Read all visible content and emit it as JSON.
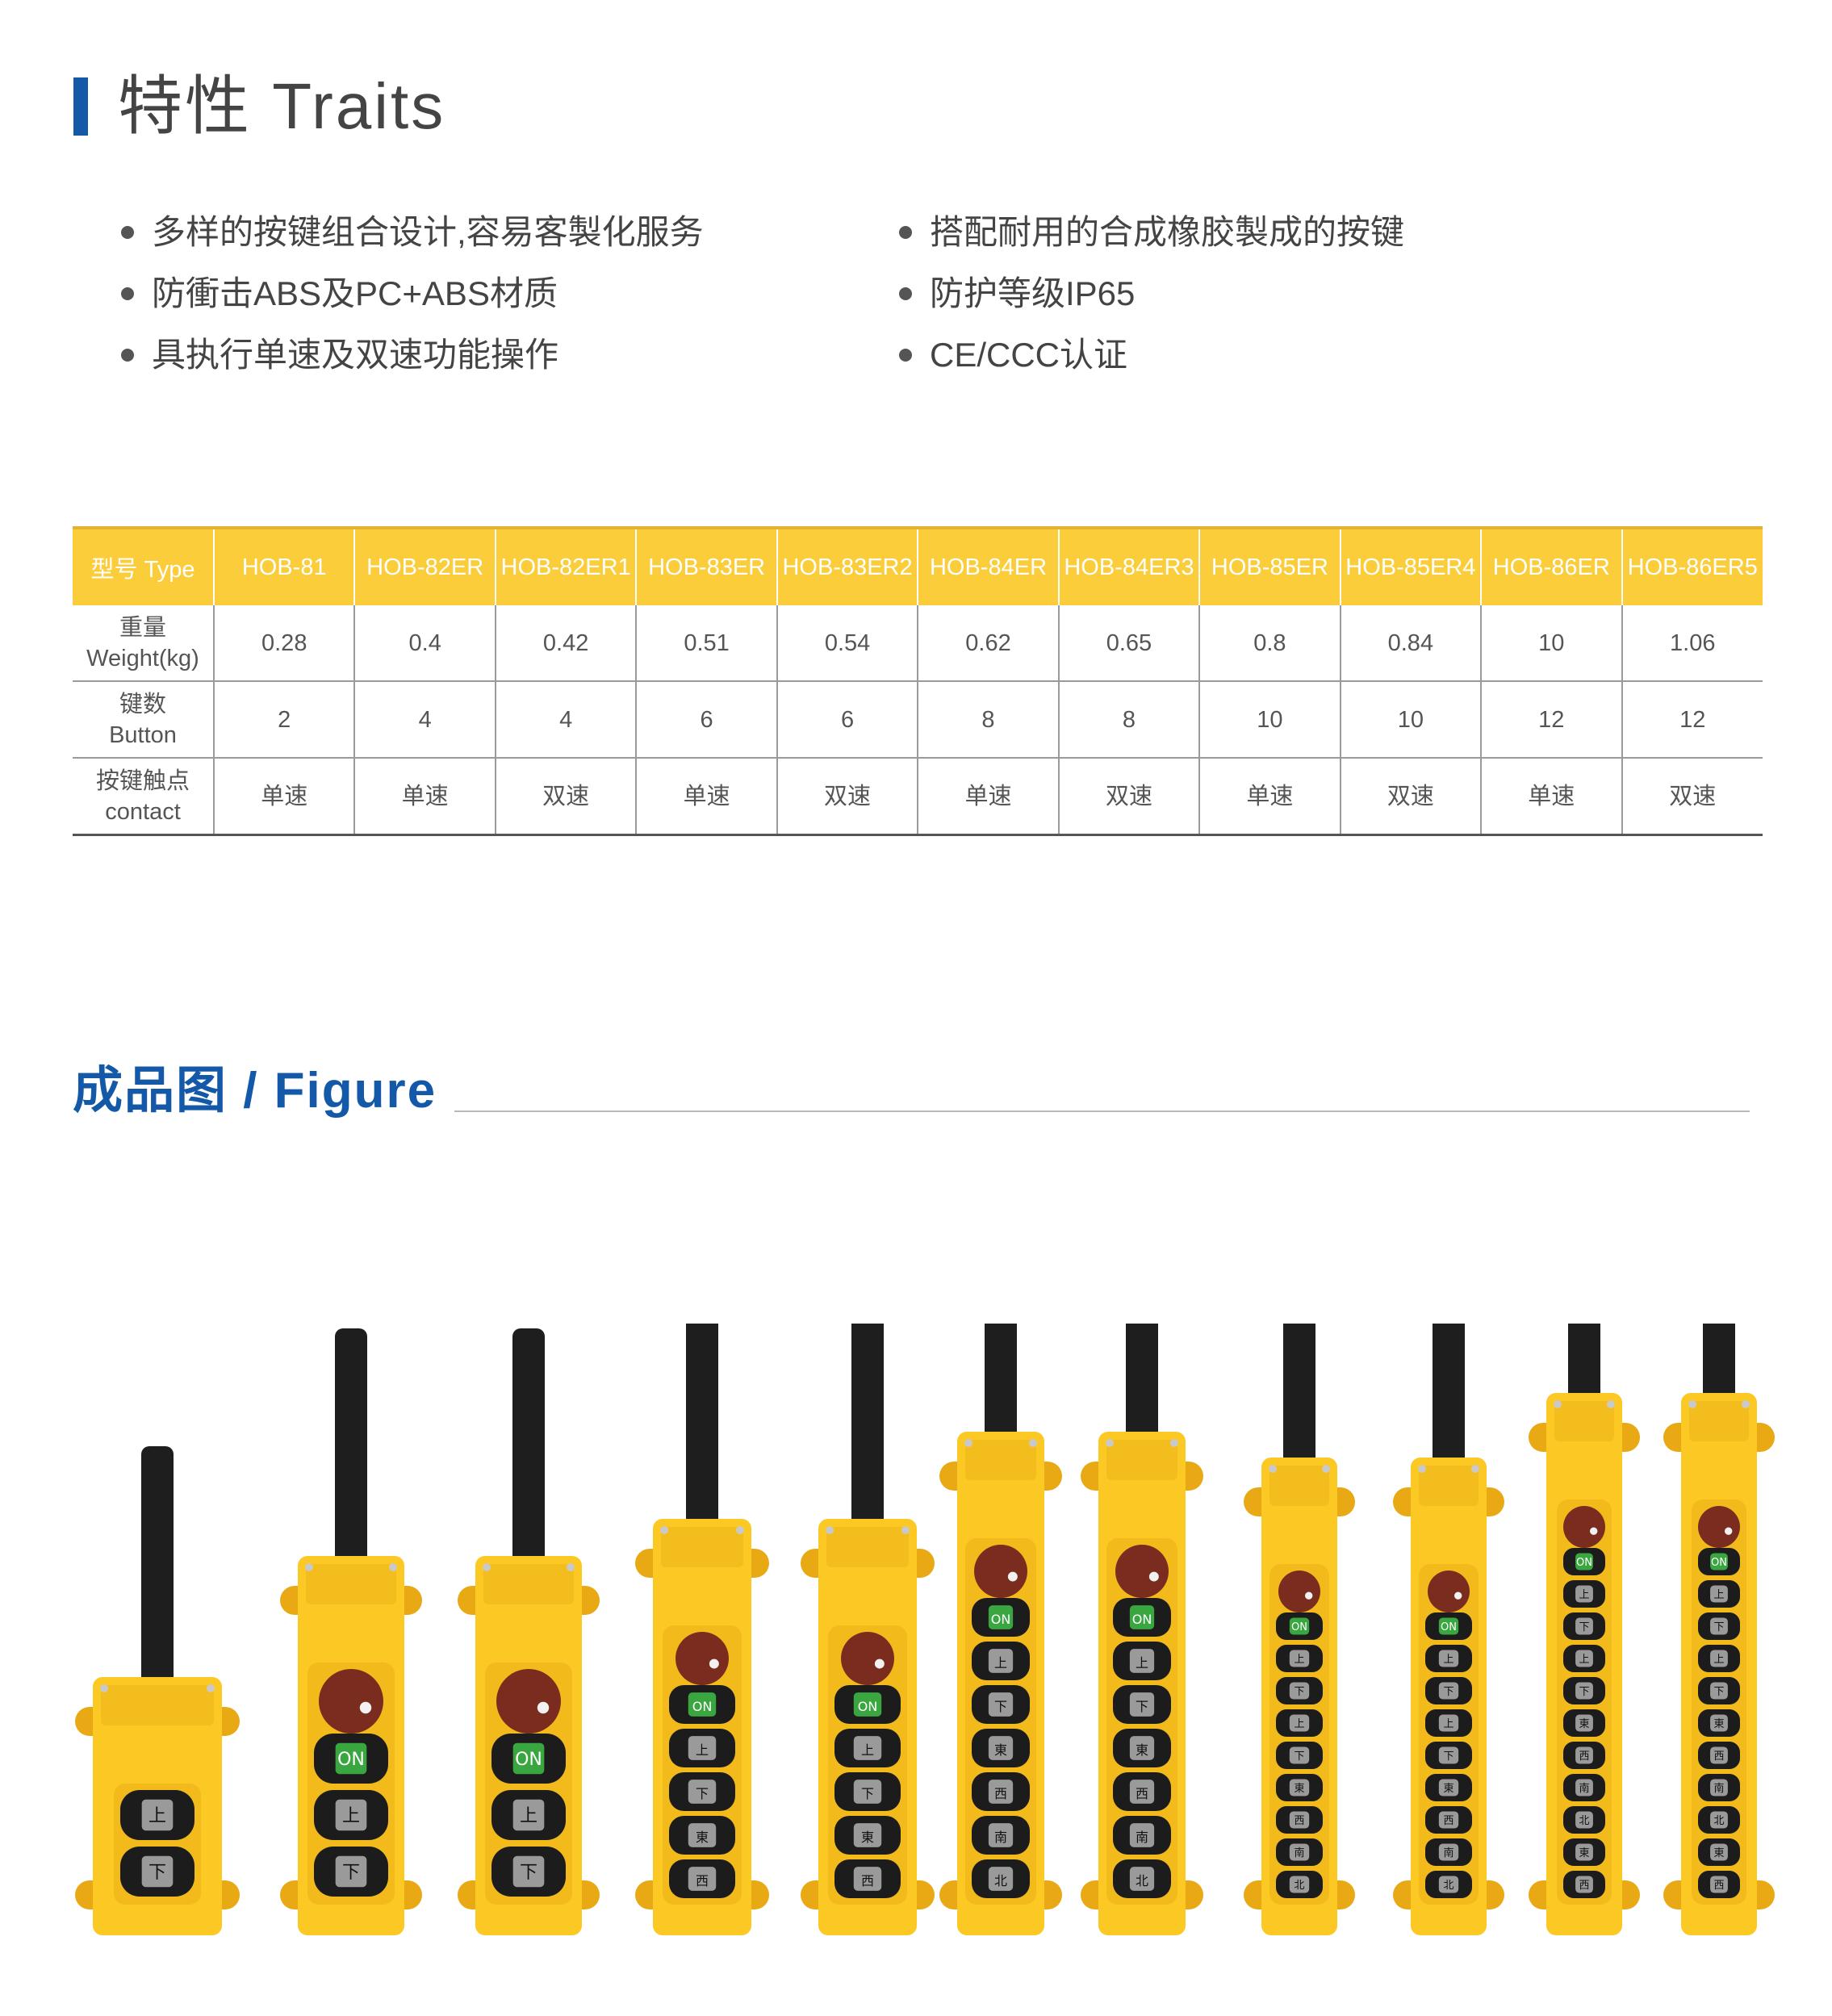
{
  "traits": {
    "title": "特性 Traits",
    "left": [
      "多样的按键组合设计,容易客製化服务",
      "防衝击ABS及PC+ABS材质",
      "具执行单速及双速功能操作"
    ],
    "right": [
      "搭配耐用的合成橡胶製成的按键",
      "防护等级IP65",
      "CE/CCC认证"
    ]
  },
  "table": {
    "header_label": "型号 Type",
    "models": [
      "HOB-81",
      "HOB-82ER",
      "HOB-82ER1",
      "HOB-83ER",
      "HOB-83ER2",
      "HOB-84ER",
      "HOB-84ER3",
      "HOB-85ER",
      "HOB-85ER4",
      "HOB-86ER",
      "HOB-86ER5"
    ],
    "rows": [
      {
        "label_cn": "重量",
        "label_en": "Weight(kg)",
        "values": [
          "0.28",
          "0.4",
          "0.42",
          "0.51",
          "0.54",
          "0.62",
          "0.65",
          "0.8",
          "0.84",
          "10",
          "1.06"
        ]
      },
      {
        "label_cn": "键数",
        "label_en": "Button",
        "values": [
          "2",
          "4",
          "4",
          "6",
          "6",
          "8",
          "8",
          "10",
          "10",
          "12",
          "12"
        ]
      },
      {
        "label_cn": "按键触点",
        "label_en": "contact",
        "values": [
          "单速",
          "单速",
          "双速",
          "单速",
          "双速",
          "单速",
          "双速",
          "单速",
          "双速",
          "单速",
          "双速"
        ]
      }
    ]
  },
  "figure": {
    "title": "成品图 / Figure",
    "pendants": [
      {
        "emergency_stop": false,
        "buttons": [
          "上",
          "下"
        ]
      },
      {
        "emergency_stop": true,
        "buttons": [
          "ON",
          "上",
          "下"
        ]
      },
      {
        "emergency_stop": true,
        "buttons": [
          "ON",
          "上",
          "下"
        ]
      },
      {
        "emergency_stop": true,
        "buttons": [
          "ON",
          "上",
          "下",
          "東",
          "西"
        ]
      },
      {
        "emergency_stop": true,
        "buttons": [
          "ON",
          "上",
          "下",
          "東",
          "西"
        ]
      },
      {
        "emergency_stop": true,
        "buttons": [
          "ON",
          "上",
          "下",
          "東",
          "西",
          "南",
          "北"
        ]
      },
      {
        "emergency_stop": true,
        "buttons": [
          "ON",
          "上",
          "下",
          "東",
          "西",
          "南",
          "北"
        ]
      },
      {
        "emergency_stop": true,
        "buttons": [
          "ON",
          "上",
          "下",
          "上",
          "下",
          "東",
          "西",
          "南",
          "北"
        ]
      },
      {
        "emergency_stop": true,
        "buttons": [
          "ON",
          "上",
          "下",
          "上",
          "下",
          "東",
          "西",
          "南",
          "北"
        ]
      },
      {
        "emergency_stop": true,
        "buttons": [
          "ON",
          "上",
          "下",
          "上",
          "下",
          "東",
          "西",
          "南",
          "北",
          "東",
          "西"
        ]
      },
      {
        "emergency_stop": true,
        "buttons": [
          "ON",
          "上",
          "下",
          "上",
          "下",
          "東",
          "西",
          "南",
          "北",
          "東",
          "西"
        ]
      }
    ],
    "colors": {
      "housing": "#fbc824",
      "housing_dark": "#e8a914",
      "cable_grip": "#1e1e1e",
      "button": "#1c1c1c",
      "button_face": "#9a9a9a",
      "on_button_face": "#3aa640",
      "emergency_stop": "#7a2d1e"
    }
  },
  "colors": {
    "accent_blue": "#1458a8",
    "table_header": "#fbcd3a"
  }
}
